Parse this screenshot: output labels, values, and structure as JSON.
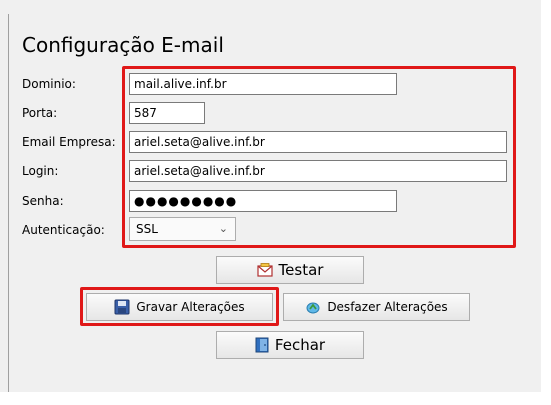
{
  "title": "Configuração E-mail",
  "labels": {
    "dominio": "Dominio:",
    "porta": "Porta:",
    "email_empresa": "Email Empresa:",
    "login": "Login:",
    "senha": "Senha:",
    "autenticacao": "Autenticação:"
  },
  "fields": {
    "dominio": "mail.alive.inf.br",
    "porta": "587",
    "email_empresa": "ariel.seta@alive.inf.br",
    "login": "ariel.seta@alive.inf.br",
    "senha_mask": "●●●●●●●●●",
    "autenticacao": "SSL"
  },
  "buttons": {
    "testar": "Testar",
    "gravar": "Gravar Alterações",
    "desfazer": "Desfazer Alterações",
    "fechar": "Fechar"
  },
  "icons": {
    "testar": "mail-envelope-icon",
    "gravar": "save-disk-icon",
    "desfazer": "undo-icon",
    "fechar": "exit-door-icon",
    "select": "chevron-down-icon"
  },
  "colors": {
    "highlight": "#e01818",
    "window_bg": "#f0f0f0"
  }
}
